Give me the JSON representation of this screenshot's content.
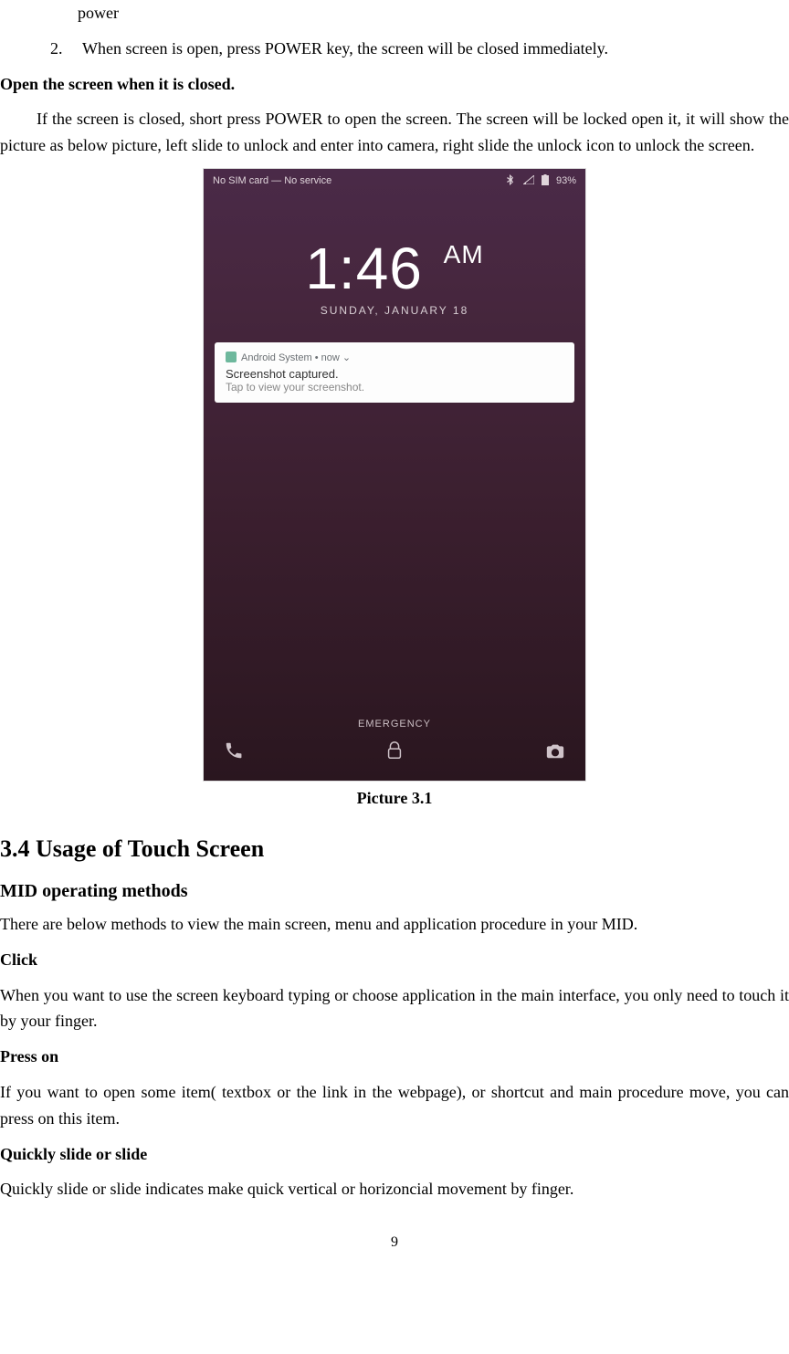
{
  "top_fragment": "power",
  "list_item_2_num": "2.",
  "list_item_2_text": "When screen is open, press POWER key, the screen will be closed immediately.",
  "heading_open": "Open the screen when it is closed.",
  "para_open": "If the screen is closed, short press POWER to open the screen. The screen will be locked open it, it will show the picture as below picture, left slide to unlock and enter into camera, right slide the unlock icon to unlock the screen.",
  "phone": {
    "status_left": "No SIM card — No service",
    "battery_pct": "93%",
    "time": "1:46",
    "ampm": "AM",
    "date": "SUNDAY, JANUARY 18",
    "notif_source": "Android System  •  now  ⌄",
    "notif_title": "Screenshot captured.",
    "notif_body": "Tap to view your screenshot.",
    "emergency": "EMERGENCY"
  },
  "caption": "Picture 3.1",
  "section_heading": "3.4 Usage of Touch Screen",
  "sub_heading": "MID operating methods",
  "para_methods": "There are below methods to view the main screen, menu and application procedure in your MID.",
  "h_click": "Click",
  "para_click": "When you want to use the screen keyboard typing or choose application in the main interface, you only need to touch it by your finger.",
  "h_press": "Press on",
  "para_press": "If you want to open some item( textbox or the link in the webpage), or shortcut and main procedure move, you can press on this item.",
  "h_slide": "Quickly slide or slide",
  "para_slide": "Quickly slide or slide indicates make quick vertical or horizoncial movement by finger.",
  "page_number": "9"
}
